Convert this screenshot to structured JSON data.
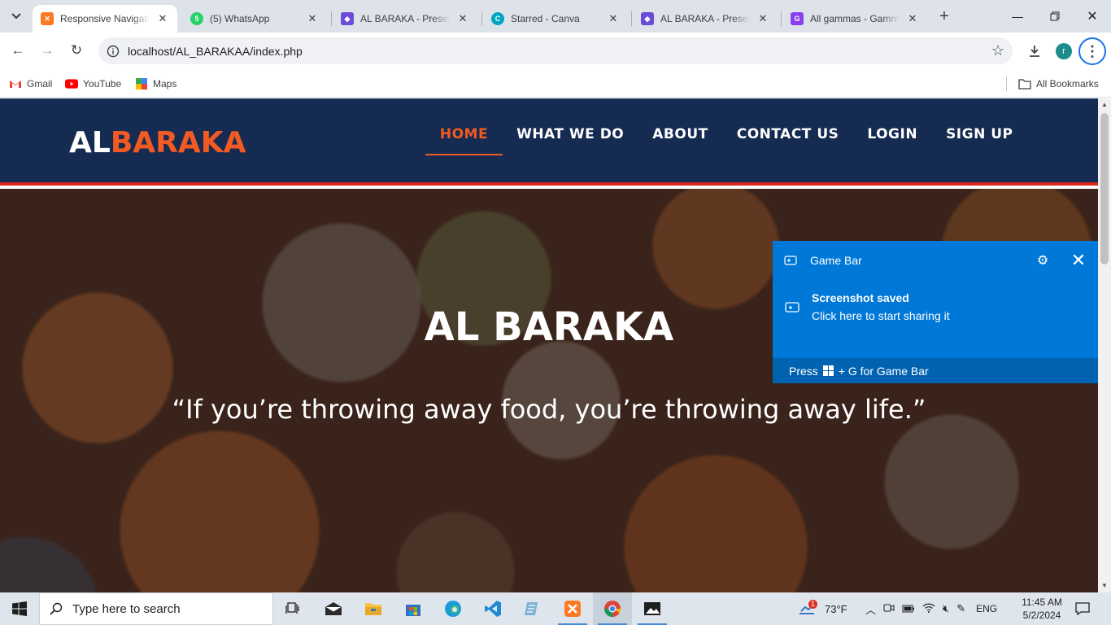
{
  "browser": {
    "tabs": [
      {
        "title": "Responsive Navigatio",
        "favicon": "xampp-icon",
        "color": "#fb7a24",
        "active": true
      },
      {
        "title": "(5) WhatsApp",
        "favicon": "whatsapp-icon",
        "color": "#25d366",
        "badge": "5",
        "active": false
      },
      {
        "title": "AL BARAKA - Present",
        "favicon": "gamma-icon",
        "color": "#6b4bd8",
        "active": false
      },
      {
        "title": "Starred - Canva",
        "favicon": "canva-icon",
        "color": "#00c4cc",
        "active": false
      },
      {
        "title": "AL BARAKA - Present",
        "favicon": "gamma-icon",
        "color": "#6b4bd8",
        "active": false
      },
      {
        "title": "All gammas - Gamma",
        "favicon": "gamma-icon",
        "color": "#8a3ff0",
        "active": false
      }
    ],
    "url": "localhost/AL_BARAKAA/index.php",
    "profile_initial": "r",
    "bookmarks": [
      {
        "label": "Gmail",
        "icon": "gmail-icon"
      },
      {
        "label": "YouTube",
        "icon": "youtube-icon"
      },
      {
        "label": "Maps",
        "icon": "maps-icon"
      }
    ],
    "all_bookmarks_label": "All Bookmarks"
  },
  "site": {
    "logo_part1": "AL",
    "logo_part2": "BARAKA",
    "nav": [
      {
        "label": "HOME",
        "active": true
      },
      {
        "label": "WHAT WE DO",
        "active": false
      },
      {
        "label": "ABOUT",
        "active": false
      },
      {
        "label": "CONTACT US",
        "active": false
      },
      {
        "label": "LOGIN",
        "active": false
      },
      {
        "label": "SIGN UP",
        "active": false
      }
    ],
    "hero_title": "AL BARAKA",
    "hero_quote": "“If you’re throwing away food, you’re throwing away life.”",
    "colors": {
      "header_bg": "#162b52",
      "accent": "#f15a22",
      "header_border": "#d9251c"
    }
  },
  "gamebar": {
    "app": "Game Bar",
    "title": "Screenshot saved",
    "message": "Click here to start sharing it",
    "footer_pre": "Press",
    "footer_post": "+ G for Game Bar",
    "color": "#0078d7"
  },
  "taskbar": {
    "search_placeholder": "Type here to search",
    "weather": "73°F",
    "weather_badge": "1",
    "language": "ENG",
    "time": "11:45 AM",
    "date": "5/2/2024"
  }
}
